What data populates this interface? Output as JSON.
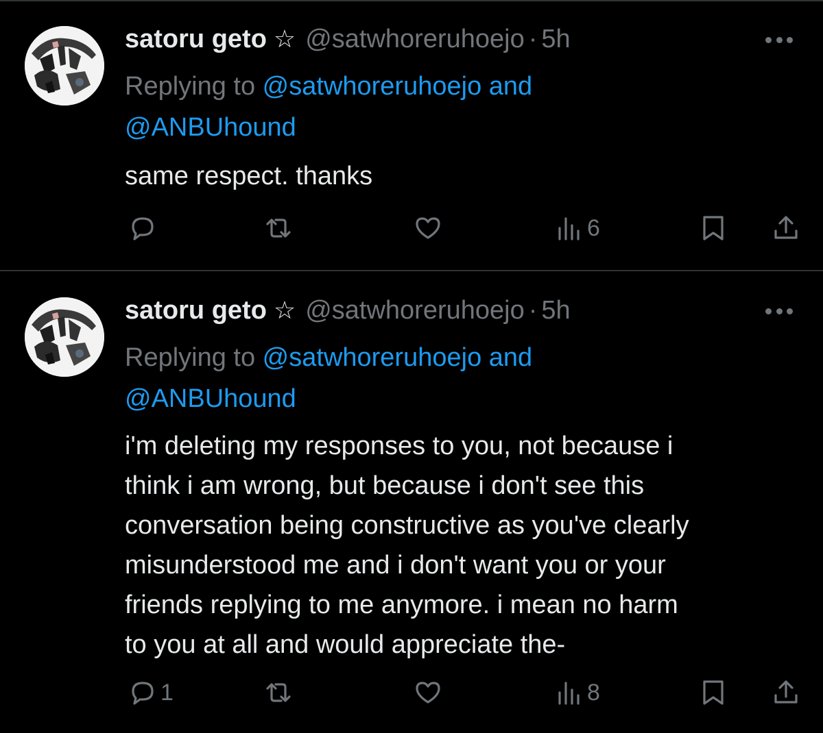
{
  "tweets": [
    {
      "author": {
        "name": "satoru geto",
        "badge": "☆",
        "handle": "@satwhoreruhoejo",
        "separator": "·",
        "time": "5h"
      },
      "reply": {
        "prefix": "Replying to ",
        "mention1": "@satwhoreruhoejo",
        "conj": " and",
        "mention2": "@ANBUhound"
      },
      "lines": [
        "same respect. thanks"
      ],
      "stats": {
        "replies": "",
        "retweets": "",
        "likes": "",
        "views": "6"
      }
    },
    {
      "author": {
        "name": "satoru geto",
        "badge": "☆",
        "handle": "@satwhoreruhoejo",
        "separator": "·",
        "time": "5h"
      },
      "reply": {
        "prefix": "Replying to ",
        "mention1": "@satwhoreruhoejo",
        "conj": " and",
        "mention2": "@ANBUhound"
      },
      "lines": [
        "i'm deleting my responses to you, not because i",
        "think i am wrong, but because i don't see this",
        "conversation being constructive as you've clearly",
        "misunderstood me and i don't want you or your",
        "friends replying to me anymore. i mean no harm",
        "to you at all and would appreciate the-"
      ],
      "stats": {
        "replies": "1",
        "retweets": "",
        "likes": "",
        "views": "8"
      }
    }
  ],
  "icons": {
    "reply": "reply-icon",
    "retweet": "retweet-icon",
    "like": "heart-icon",
    "views": "views-chart-icon",
    "bookmark": "bookmark-icon",
    "share": "share-icon",
    "more": "more-dots-icon"
  },
  "colors": {
    "background": "#000000",
    "text": "#e7e9ea",
    "secondary": "#71767b",
    "link": "#1d9bf0",
    "divider": "#2f3336"
  }
}
